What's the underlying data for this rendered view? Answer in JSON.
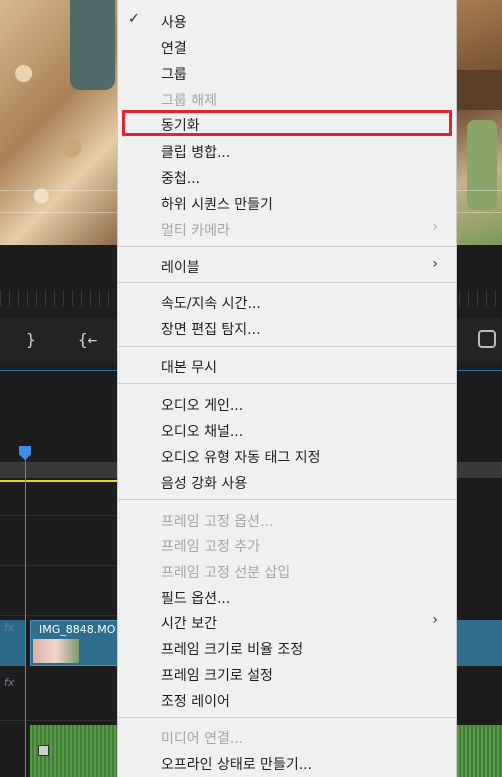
{
  "background": {
    "clip_name": "IMG_8848.MO",
    "fx_label": "fx"
  },
  "menu": {
    "items": [
      {
        "label": "사용",
        "checked": true,
        "disabled": false,
        "submenu": false
      },
      {
        "label": "연결",
        "checked": false,
        "disabled": false,
        "submenu": false
      },
      {
        "label": "그룹",
        "checked": false,
        "disabled": false,
        "submenu": false
      },
      {
        "label": "그룹 해제",
        "checked": false,
        "disabled": true,
        "submenu": false
      },
      {
        "label": "동기화",
        "checked": false,
        "disabled": false,
        "submenu": false,
        "highlighted": true
      },
      {
        "label": "클립 병합...",
        "checked": false,
        "disabled": false,
        "submenu": false
      },
      {
        "label": "중첩...",
        "checked": false,
        "disabled": false,
        "submenu": false
      },
      {
        "label": "하위 시퀀스 만들기",
        "checked": false,
        "disabled": false,
        "submenu": false
      },
      {
        "label": "멀티 카메라",
        "checked": false,
        "disabled": true,
        "submenu": true
      },
      {
        "label": "레이블",
        "checked": false,
        "disabled": false,
        "submenu": true
      },
      {
        "label": "속도/지속 시간...",
        "checked": false,
        "disabled": false,
        "submenu": false
      },
      {
        "label": "장면 편집 탐지...",
        "checked": false,
        "disabled": false,
        "submenu": false
      },
      {
        "label": "대본 무시",
        "checked": false,
        "disabled": false,
        "submenu": false
      },
      {
        "label": "오디오 게인...",
        "checked": false,
        "disabled": false,
        "submenu": false
      },
      {
        "label": "오디오 채널...",
        "checked": false,
        "disabled": false,
        "submenu": false
      },
      {
        "label": "오디오 유형 자동 태그 지정",
        "checked": false,
        "disabled": false,
        "submenu": false
      },
      {
        "label": "음성 강화 사용",
        "checked": false,
        "disabled": false,
        "submenu": false
      },
      {
        "label": "프레임 고정 옵션...",
        "checked": false,
        "disabled": true,
        "submenu": false
      },
      {
        "label": "프레임 고정 추가",
        "checked": false,
        "disabled": true,
        "submenu": false
      },
      {
        "label": "프레임 고정 선분 삽입",
        "checked": false,
        "disabled": true,
        "submenu": false
      },
      {
        "label": "필드 옵션...",
        "checked": false,
        "disabled": false,
        "submenu": false
      },
      {
        "label": "시간 보간",
        "checked": false,
        "disabled": false,
        "submenu": true
      },
      {
        "label": "프레임 크기로 비율 조정",
        "checked": false,
        "disabled": false,
        "submenu": false
      },
      {
        "label": "프레임 크기로 설정",
        "checked": false,
        "disabled": false,
        "submenu": false
      },
      {
        "label": "조정 레이어",
        "checked": false,
        "disabled": false,
        "submenu": false
      },
      {
        "label": "미디어 연결...",
        "checked": false,
        "disabled": true,
        "submenu": false
      },
      {
        "label": "오프라인 상태로 만들기...",
        "checked": false,
        "disabled": false,
        "submenu": false
      }
    ],
    "check_glyph": "✓",
    "arrow_glyph": "›",
    "highlight_color": "#e0262c"
  }
}
